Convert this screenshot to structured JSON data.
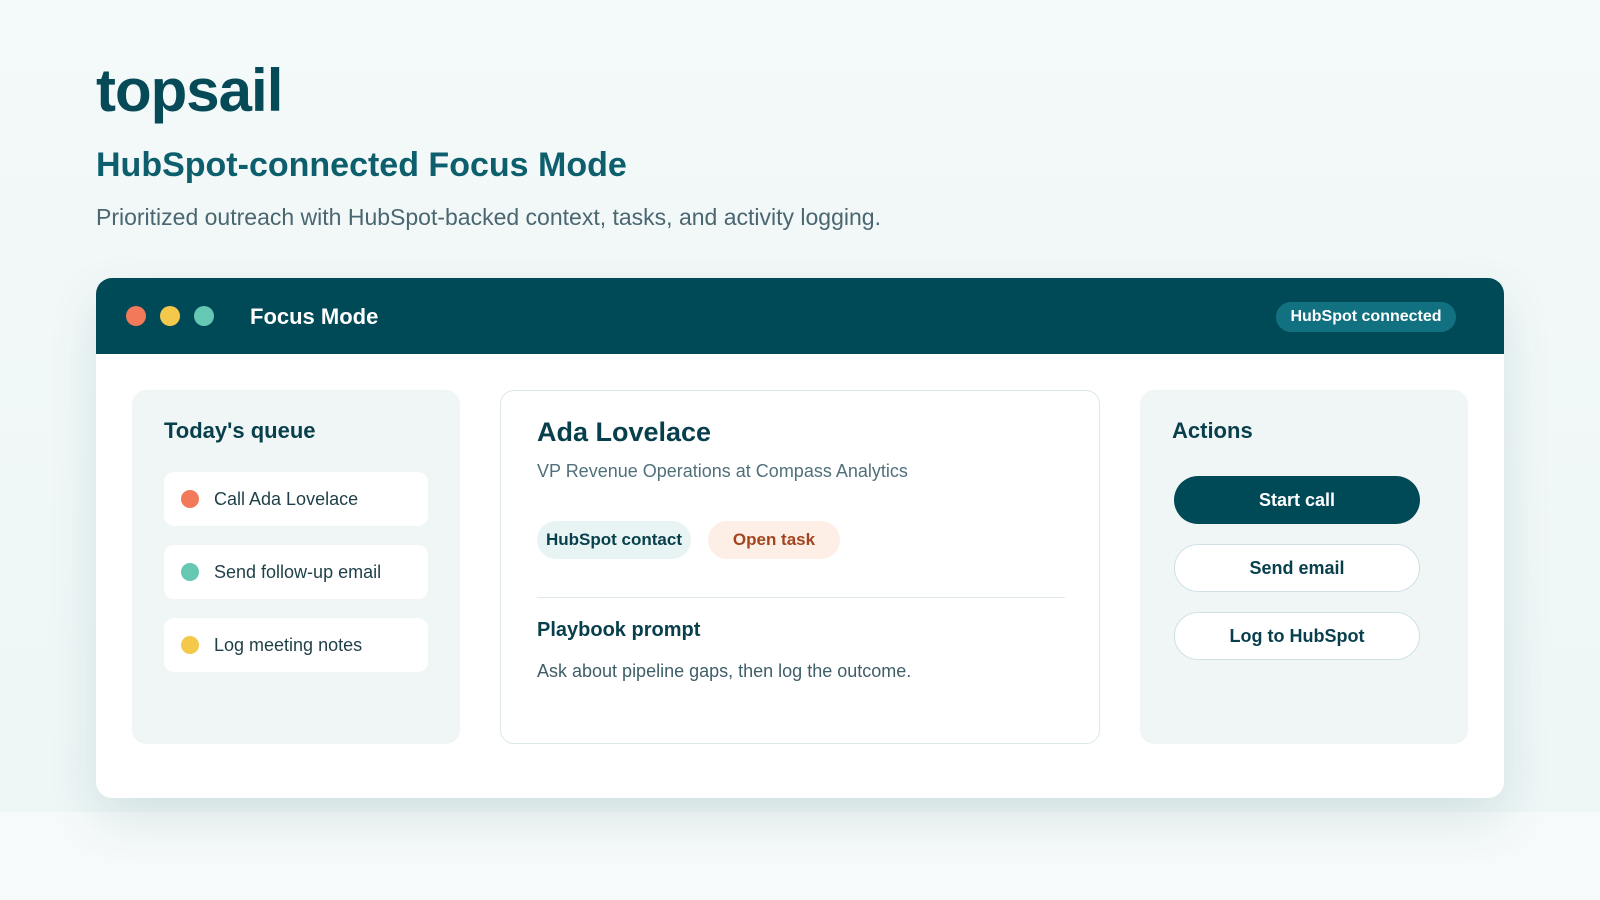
{
  "brand": "topsail",
  "headline": "HubSpot-connected Focus Mode",
  "subline": "Prioritized outreach with HubSpot-backed context, tasks, and activity logging.",
  "window": {
    "title": "Focus Mode",
    "status_pill": "HubSpot connected"
  },
  "queue": {
    "title": "Today's queue",
    "items": [
      {
        "label": "Call Ada Lovelace",
        "color": "#f2795a"
      },
      {
        "label": "Send follow-up email",
        "color": "#66c8b3"
      },
      {
        "label": "Log meeting notes",
        "color": "#f4c84a"
      }
    ]
  },
  "contact": {
    "name": "Ada Lovelace",
    "role": "VP Revenue Operations at Compass Analytics",
    "tags": [
      "HubSpot contact",
      "Open task"
    ],
    "playbook_title": "Playbook prompt",
    "playbook_text": "Ask about pipeline gaps, then log the outcome."
  },
  "actions": {
    "title": "Actions",
    "start_call": "Start call",
    "send_email": "Send email",
    "log_hubspot": "Log to HubSpot"
  },
  "colors": {
    "brand_dark": "#004a58",
    "accent_teal": "#127180",
    "dot_red": "#f2795a",
    "dot_yellow": "#f4c84a",
    "dot_green": "#66c8b3"
  }
}
